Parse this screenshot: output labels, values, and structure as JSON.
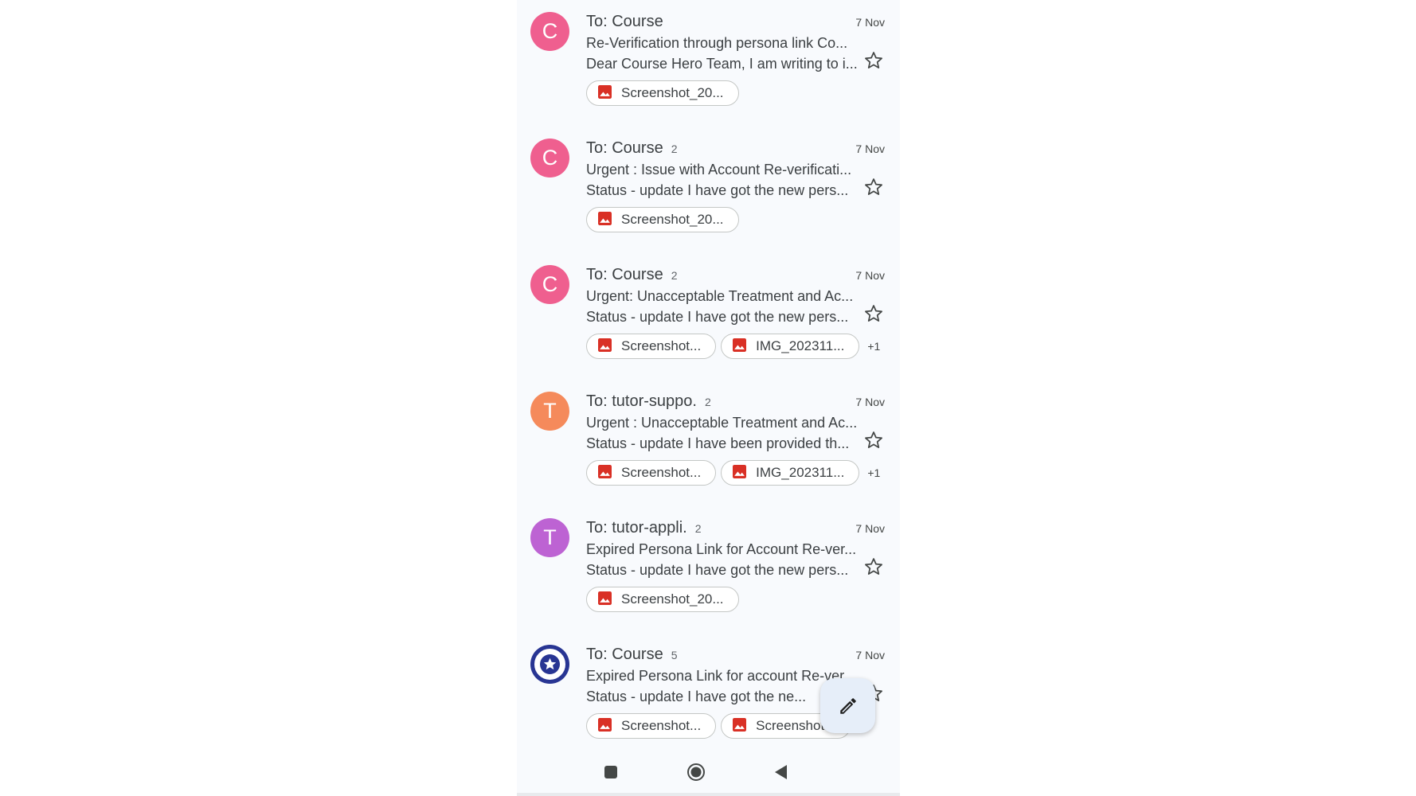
{
  "colors": {
    "avatar_c": "#ef5f8f",
    "avatar_t_orange": "#f58a5b",
    "avatar_t_purple": "#bd63d3",
    "avatar_logo": "#283593",
    "attachment_icon": "#d93025"
  },
  "emails": [
    {
      "avatar_letter": "C",
      "sender": "To: Course",
      "count": "",
      "date": "7 Nov",
      "subject": "Re-Verification through persona link Co...",
      "snippet": "Dear Course Hero Team, I am writing to i...",
      "attachments": [
        "Screenshot_20..."
      ],
      "more": ""
    },
    {
      "avatar_letter": "C",
      "sender": "To: Course",
      "count": "2",
      "date": "7 Nov",
      "subject": "Urgent : Issue with Account Re-verificati...",
      "snippet": "Status - update I have got the new pers...",
      "attachments": [
        "Screenshot_20..."
      ],
      "more": ""
    },
    {
      "avatar_letter": "C",
      "sender": "To: Course",
      "count": "2",
      "date": "7 Nov",
      "subject": "Urgent: Unacceptable Treatment and Ac...",
      "snippet": "Status - update I have got the new pers...",
      "attachments": [
        "Screenshot...",
        "IMG_202311..."
      ],
      "more": "+1"
    },
    {
      "avatar_letter": "T",
      "sender": "To: tutor-suppo.",
      "count": "2",
      "date": "7 Nov",
      "subject": "Urgent : Unacceptable Treatment and Ac...",
      "snippet": "Status - update I have been provided th...",
      "attachments": [
        "Screenshot...",
        "IMG_202311..."
      ],
      "more": "+1"
    },
    {
      "avatar_letter": "T",
      "sender": "To: tutor-appli.",
      "count": "2",
      "date": "7 Nov",
      "subject": "Expired Persona Link for Account Re-ver...",
      "snippet": "Status - update I have got the new pers...",
      "attachments": [
        "Screenshot_20..."
      ],
      "more": ""
    },
    {
      "avatar_letter": "",
      "sender": "To: Course",
      "count": "5",
      "date": "7 Nov",
      "subject": "Expired Persona Link for account Re-ver...",
      "snippet": "Status - update I have got the ne...",
      "attachments": [
        "Screenshot...",
        "Screenshot..."
      ],
      "more": ""
    }
  ],
  "fab": {
    "icon": "pencil-icon"
  },
  "navbar": {
    "icons": [
      "recents-square-icon",
      "home-circle-icon",
      "back-triangle-icon"
    ]
  }
}
